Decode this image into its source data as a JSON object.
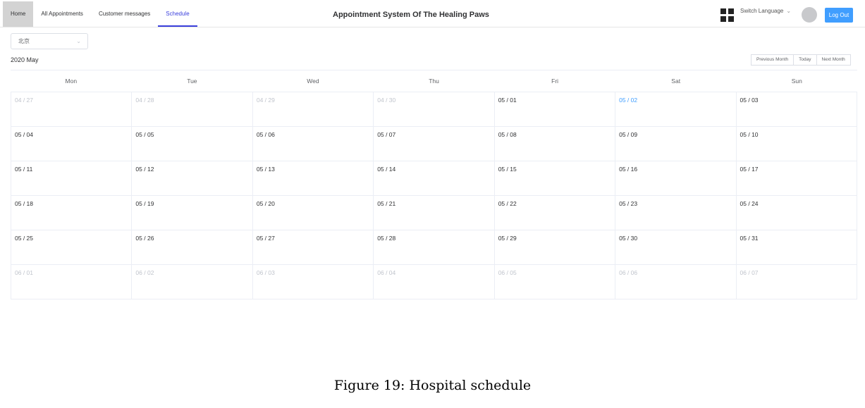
{
  "nav": {
    "items": [
      {
        "label": "Home"
      },
      {
        "label": "All Appointments"
      },
      {
        "label": "Customer messages"
      },
      {
        "label": "Schedule"
      }
    ]
  },
  "header": {
    "title": "Appointment System Of The Healing Paws",
    "switch_language": "Switch Language",
    "logout_label": "Log Out",
    "colors": {
      "accent": "#409eff",
      "active_tab": "#3a3fdc",
      "home_tab_bg": "#d3d3d3"
    },
    "icons": {
      "apps": "grid-apps-icon",
      "language_chevron": "chevron-down-icon",
      "avatar": "user-avatar"
    }
  },
  "filters": {
    "city_value": "北京"
  },
  "calendar": {
    "title": "2020 May",
    "buttons": {
      "prev": "Previous Month",
      "today": "Today",
      "next": "Next Month"
    },
    "weekdays": [
      "Mon",
      "Tue",
      "Wed",
      "Thu",
      "Fri",
      "Sat",
      "Sun"
    ],
    "weeks": [
      [
        "04 / 27",
        "04 / 28",
        "04 / 29",
        "04 / 30",
        "05 / 01",
        "05 / 02",
        "05 / 03"
      ],
      [
        "05 / 04",
        "05 / 05",
        "05 / 06",
        "05 / 07",
        "05 / 08",
        "05 / 09",
        "05 / 10"
      ],
      [
        "05 / 11",
        "05 / 12",
        "05 / 13",
        "05 / 14",
        "05 / 15",
        "05 / 16",
        "05 / 17"
      ],
      [
        "05 / 18",
        "05 / 19",
        "05 / 20",
        "05 / 21",
        "05 / 22",
        "05 / 23",
        "05 / 24"
      ],
      [
        "05 / 25",
        "05 / 26",
        "05 / 27",
        "05 / 28",
        "05 / 29",
        "05 / 30",
        "05 / 31"
      ],
      [
        "06 / 01",
        "06 / 02",
        "06 / 03",
        "06 / 04",
        "06 / 05",
        "06 / 06",
        "06 / 07"
      ]
    ],
    "today": "05 / 02",
    "current_month_prefix": "05"
  },
  "caption": "Figure 19: Hospital schedule"
}
